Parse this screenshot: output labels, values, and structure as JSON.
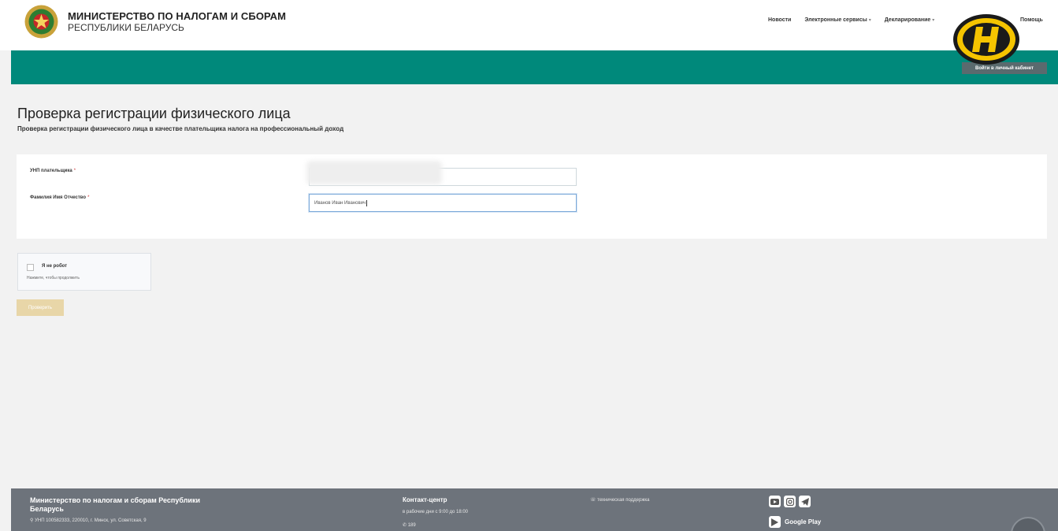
{
  "header": {
    "brand_title": "МИНИСТЕРСТВО ПО НАЛОГАМ И СБОРАМ",
    "brand_subtitle": "РЕСПУБЛИКИ БЕЛАРУСЬ",
    "nav": [
      {
        "label": "Новости"
      },
      {
        "label": "Электронные сервисы"
      },
      {
        "label": "Декларирование"
      }
    ],
    "nav_help": "Помощь",
    "login_label": "Войти в личный кабинет"
  },
  "main": {
    "title": "Проверка регистрации физического лица",
    "subtitle": "Проверка регистрации физического лица в качестве плательщика налога на профессиональный доход",
    "fields": [
      {
        "label": "УНП плательщика",
        "value": ""
      },
      {
        "label": "Фамилия Имя Отчество",
        "value": "Иванов Иван Иванович"
      }
    ],
    "captcha": {
      "label": "Я не робот",
      "hint": "Нажмите, чтобы продолжить"
    },
    "submit_label": "Проверить"
  },
  "footer": {
    "org_name": "Министерство по налогам и сборам Республики Беларусь",
    "address": "УНП 100582333, 220010, г. Минск, ул. Советская, 9",
    "contact_title": "Контакт-центр",
    "contact_hours": "в рабочие дни с 9:00 до 18:00",
    "contact_phone": "189",
    "support": "техническая поддержка",
    "google_play": "Google Play"
  },
  "colors": {
    "teal": "#00897b",
    "footer": "#6d737b",
    "button": "#e8d6a8"
  }
}
